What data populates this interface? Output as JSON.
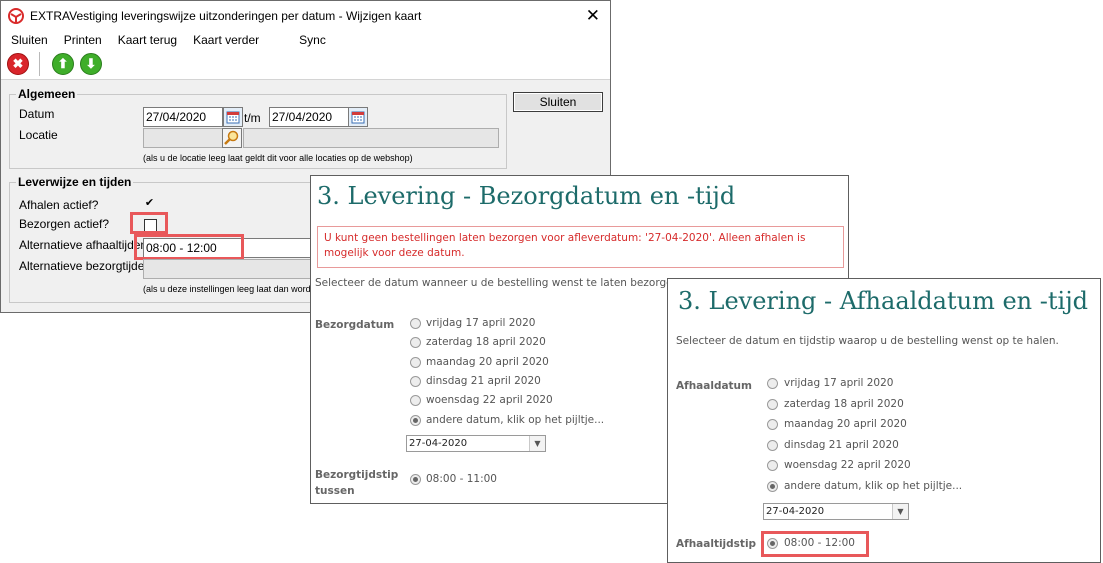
{
  "dialog": {
    "title": "EXTRAVestiging leveringswijze uitzonderingen per datum - Wijzigen kaart",
    "menu": [
      "Sluiten",
      "Printen",
      "Kaart terug",
      "Kaart verder",
      "Sync"
    ],
    "algemeen": {
      "legend": "Algemeen",
      "datum_label": "Datum",
      "datum_from": "27/04/2020",
      "tm": "t/m",
      "datum_to": "27/04/2020",
      "locatie_label": "Locatie",
      "locatie_value": "",
      "hint": "(als u de locatie leeg laat geldt dit voor alle locaties op de webshop)",
      "sluiten_button": "Sluiten"
    },
    "leverwijze": {
      "legend": "Leverwijze en tijden",
      "afhalen_label": "Afhalen actief?",
      "afhalen_checked": "✔",
      "bezorgen_label": "Bezorgen actief?",
      "afhaaltijden_label": "Alternatieve afhaaltijden",
      "afhaaltijden_value": "08:00 - 12:00",
      "bezorgtijden_label": "Alternatieve bezorgtijden",
      "bezorgtijden_value": "",
      "hint": "(als u deze instellingen leeg laat dan word"
    }
  },
  "bezorg_panel": {
    "title": "3. Levering - Bezorgdatum en -tijd",
    "error": "U kunt geen bestellingen laten bezorgen voor afleverdatum: '27-04-2020'. Alleen afhalen is mogelijk voor deze datum.",
    "intro": "Selecteer de datum wanneer u de bestelling wenst te laten bezorgen.",
    "datum_label": "Bezorgdatum",
    "options": [
      "vrijdag 17 april 2020",
      "zaterdag 18 april 2020",
      "maandag 20 april 2020",
      "dinsdag 21 april 2020",
      "woensdag 22 april 2020",
      "andere datum, klik op het pijltje..."
    ],
    "selected_index": 5,
    "date_select": "27-04-2020",
    "tijd_label_1": "Bezorgtijdstip",
    "tijd_label_2": "tussen",
    "tijd_option": "08:00 - 11:00"
  },
  "afhaal_panel": {
    "title": "3. Levering - Afhaaldatum en -tijd",
    "intro": "Selecteer de datum en tijdstip waarop u de bestelling wenst op te halen.",
    "datum_label": "Afhaaldatum",
    "options": [
      "vrijdag 17 april 2020",
      "zaterdag 18 april 2020",
      "maandag 20 april 2020",
      "dinsdag 21 april 2020",
      "woensdag 22 april 2020",
      "andere datum, klik op het pijltje..."
    ],
    "selected_index": 5,
    "date_select": "27-04-2020",
    "tijd_label": "Afhaaltijdstip",
    "tijd_option": "08:00 - 12:00"
  },
  "colors": {
    "heading": "#1d6b6a",
    "error": "#d62b2b",
    "highlight": "#e8585a"
  }
}
